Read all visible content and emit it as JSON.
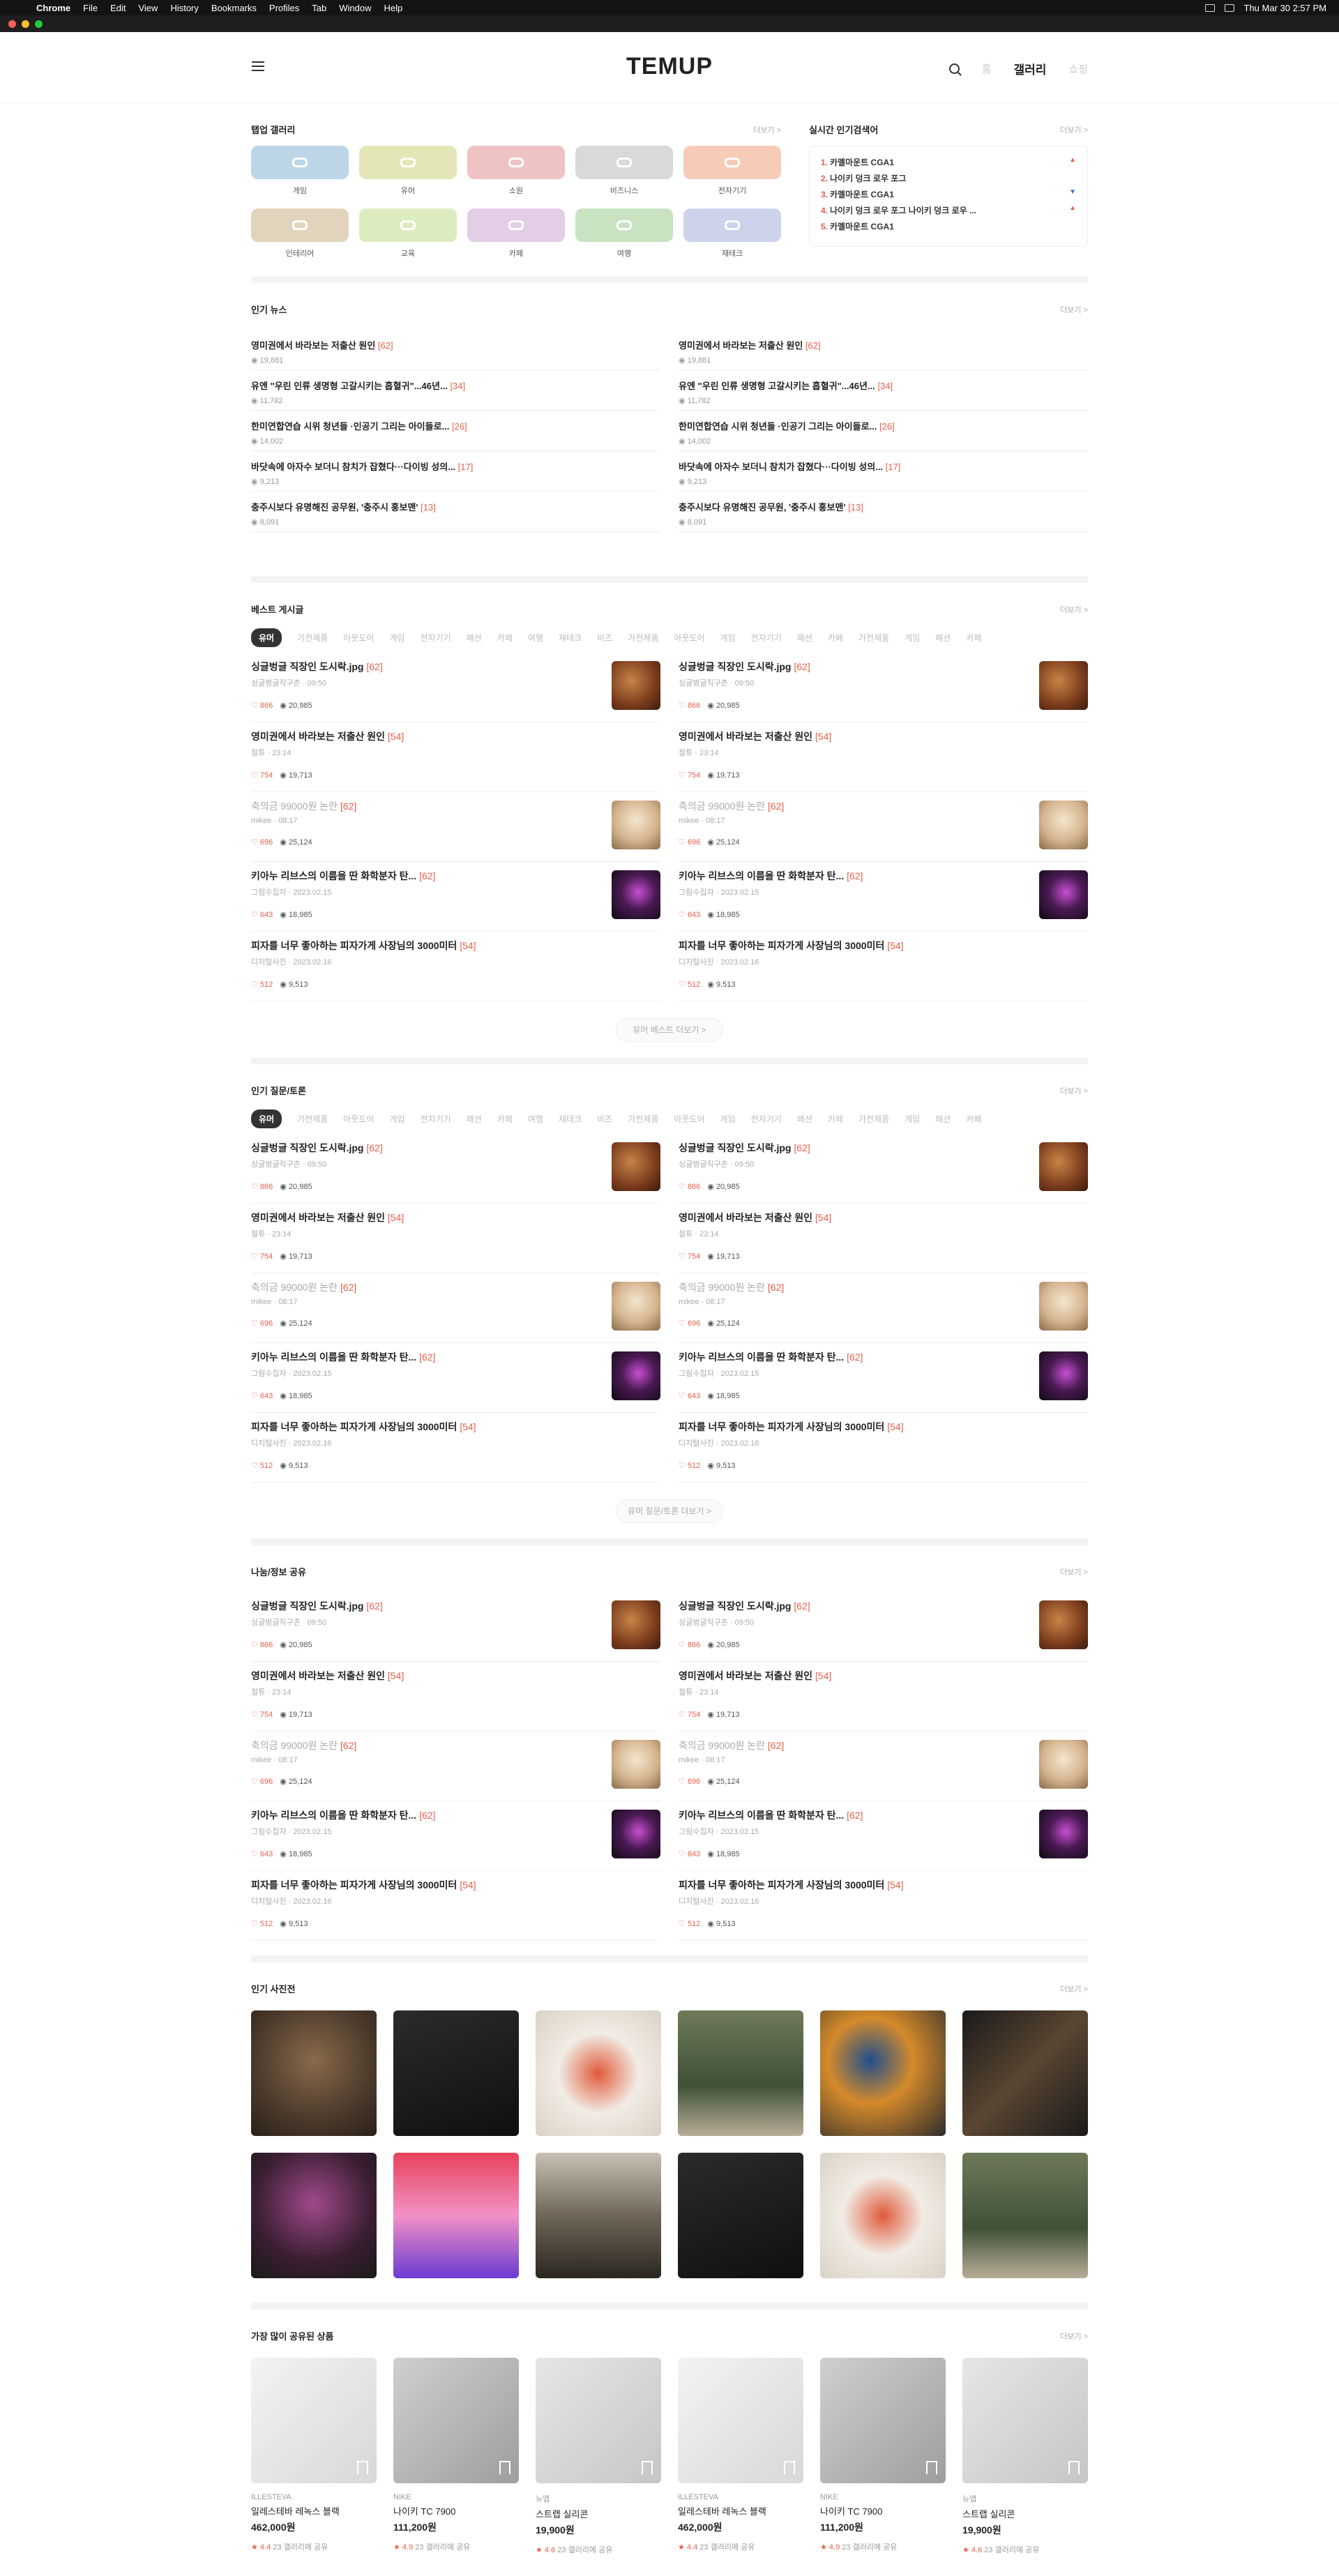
{
  "os": {
    "app": "Chrome",
    "menus": [
      "File",
      "Edit",
      "View",
      "History",
      "Bookmarks",
      "Profiles",
      "Tab",
      "Window",
      "Help"
    ],
    "clock": "Thu Mar 30  2:57 PM"
  },
  "header": {
    "logo": "TEMUP",
    "nav_dim": "홈",
    "nav_active": "갤러리",
    "nav_shop": "쇼핑"
  },
  "gallery": {
    "title": "탭업 갤러리",
    "more": "더보기 >",
    "items": [
      {
        "label": "게임",
        "color": "#bcd6e7"
      },
      {
        "label": "유머",
        "color": "#e4e6b8"
      },
      {
        "label": "소원",
        "color": "#efc3c3"
      },
      {
        "label": "비즈니스",
        "color": "#d9d9d9"
      },
      {
        "label": "전자기기",
        "color": "#f6ccb8"
      },
      {
        "label": "인테리어",
        "color": "#e2d4bc"
      },
      {
        "label": "교육",
        "color": "#dcecc0"
      },
      {
        "label": "카페",
        "color": "#e3cde7"
      },
      {
        "label": "여행",
        "color": "#c9e3c2"
      },
      {
        "label": "재테크",
        "color": "#ced3ec"
      }
    ]
  },
  "realtime": {
    "title": "실시간 인기검색어",
    "more": "더보기 >",
    "items": [
      {
        "n": "1.",
        "t": "카멜마운트 CGA1",
        "dir": "up"
      },
      {
        "n": "2.",
        "t": "나이키 덩크 로우 포그",
        "dir": ""
      },
      {
        "n": "3.",
        "t": "카멜마운트 CGA1",
        "dir": "down"
      },
      {
        "n": "4.",
        "t": "나이키 덩크 로우 포그 나이키 덩크 로우 ...",
        "dir": "up"
      },
      {
        "n": "5.",
        "t": "카멜마운트 CGA1",
        "dir": ""
      }
    ]
  },
  "news": {
    "title": "인기 뉴스",
    "more": "더보기 >",
    "items": [
      {
        "t": "영미권에서 바라보는 저출산 원인",
        "c": "[62]",
        "v": "19,881"
      },
      {
        "t": "유엔 \"우린 인류 생명형 고갈시키는 흡혈귀\"...46년...",
        "c": "[34]",
        "v": "11,782"
      },
      {
        "t": "한미연합연습 시위 청년들 ·인공기 그리는 아이들로...",
        "c": "[26]",
        "v": "14,002"
      },
      {
        "t": "바닷속에 아자수 보더니 참치가 잡혔다···다이빙 성의...",
        "c": "[17]",
        "v": "9,213"
      },
      {
        "t": "충주시보다 유명해진 공무원, '충주시 홍보맨'",
        "c": "[13]",
        "v": "8,091"
      }
    ]
  },
  "posts": [
    {
      "t": "싱글벙글 직장인 도시락.jpg",
      "c": "[62]",
      "m": "싱글벙글직구촌 · 09:50",
      "l": "866",
      "v": "20,985",
      "img": "food",
      "light": false
    },
    {
      "t": "영미권에서 바라보는 저출산 원인",
      "c": "[54]",
      "m": "절튜 · 23:14",
      "l": "754",
      "v": "19,713",
      "img": "",
      "light": false
    },
    {
      "t": "축의금 99000원 논란",
      "c": "[62]",
      "m": "mikee · 08:17",
      "l": "696",
      "v": "25,124",
      "img": "flower",
      "light": true
    },
    {
      "t": "키아누 리브스의 이름을 딴 화학분자 탄...",
      "c": "[62]",
      "m": "그림수집자 · 2023.02.15",
      "l": "643",
      "v": "18,985",
      "img": "dark",
      "light": false
    },
    {
      "t": "피자를 너무 좋아하는 피자가게 사장님의 3000미터",
      "c": "[54]",
      "m": "디지털사진 · 2023.02.16",
      "l": "512",
      "v": "9,513",
      "img": "",
      "light": false
    }
  ],
  "best": {
    "title": "베스트 게시글",
    "more": "더보기 >",
    "button": "유머 베스트 더보기 >"
  },
  "qna": {
    "title": "인기 질문/토론",
    "more": "더보기 >",
    "button": "유머 질문/토론 더보기 >"
  },
  "share": {
    "title": "나눔/정보 공유",
    "more": "더보기 >"
  },
  "tabs": [
    "유머",
    "가전제품",
    "아웃도어",
    "게임",
    "전자기기",
    "패션",
    "카페",
    "여행",
    "재테크",
    "비즈",
    "가전제품",
    "아웃도어",
    "게임",
    "전자기기",
    "패션",
    "카페",
    "가전제품",
    "게임",
    "패션",
    "카페"
  ],
  "photos": {
    "title": "인기 사진전",
    "more": "더보기 >"
  },
  "products": {
    "title": "가장 많이 공유된 상품",
    "more": "더보기 >",
    "items": [
      {
        "brand": "ILLESTEVA",
        "name": "일레스테바 레녹스 블랙",
        "price": "462,000원",
        "rating": "4.4",
        "share": "23",
        "share_label": "갤러리에 공유"
      },
      {
        "brand": "NIKE",
        "name": "나이키 TC 7900",
        "price": "111,200원",
        "rating": "4.9",
        "share": "23",
        "share_label": "갤러리에 공유"
      },
      {
        "brand": "뉴앱",
        "name": "스트랩 실리콘",
        "price": "19,900원",
        "rating": "4.6",
        "share": "23",
        "share_label": "갤러리에 공유"
      },
      {
        "brand": "ILLESTEVA",
        "name": "일레스테바 레녹스 블랙",
        "price": "462,000원",
        "rating": "4.4",
        "share": "23",
        "share_label": "갤러리에 공유"
      },
      {
        "brand": "NIKE",
        "name": "나이키 TC 7900",
        "price": "111,200원",
        "rating": "4.9",
        "share": "23",
        "share_label": "갤러리에 공유"
      },
      {
        "brand": "뉴앱",
        "name": "스트랩 실리콘",
        "price": "19,900원",
        "rating": "4.6",
        "share": "23",
        "share_label": "갤러리에 공유"
      }
    ]
  }
}
